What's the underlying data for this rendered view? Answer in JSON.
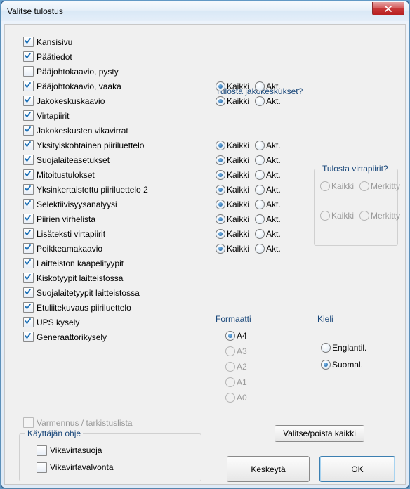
{
  "window": {
    "title": "Valitse tulostus"
  },
  "checks": [
    {
      "label": "Kansisivu",
      "checked": true
    },
    {
      "label": "Päätiedot",
      "checked": true
    },
    {
      "label": "Pääjohtokaavio, pysty",
      "checked": false
    },
    {
      "label": "Pääjohtokaavio, vaaka",
      "checked": true
    },
    {
      "label": "Jakokeskuskaavio",
      "checked": true
    },
    {
      "label": "Virtapiirit",
      "checked": true
    },
    {
      "label": "Jakokeskusten vikavirrat",
      "checked": true
    },
    {
      "label": "Yksityiskohtainen piiriluettelo",
      "checked": true
    },
    {
      "label": "Suojalaiteasetukset",
      "checked": true
    },
    {
      "label": "Mitoitustulokset",
      "checked": true
    },
    {
      "label": "Yksinkertaistettu piiriluettelo 2",
      "checked": true
    },
    {
      "label": "Selektiivisyysanalyysi",
      "checked": true
    },
    {
      "label": "Piirien virhelista",
      "checked": true
    },
    {
      "label": "Lisäteksti virtapiirit",
      "checked": true
    },
    {
      "label": "Poikkeamakaavio",
      "checked": true
    },
    {
      "label": "Laitteiston kaapelityypit",
      "checked": true
    },
    {
      "label": "Kiskotyypit laitteistossa",
      "checked": true
    },
    {
      "label": "Suojalaitetyypit laitteistossa",
      "checked": true
    },
    {
      "label": "Etuliitekuvaus piiriluettelo",
      "checked": true
    },
    {
      "label": "UPS kysely",
      "checked": true
    },
    {
      "label": "Generaattorikysely",
      "checked": true
    }
  ],
  "jakokeskukset": {
    "title": "Tulosta jakokeskukset?",
    "opt_all": "Kaikki",
    "opt_act": "Akt."
  },
  "virtapiirit": {
    "title": "Tulosta virtapiirit?",
    "opt_all": "Kaikki",
    "opt_marked": "Merkitty"
  },
  "format": {
    "title": "Formaatti",
    "options": [
      "A4",
      "A3",
      "A2",
      "A1",
      "A0"
    ],
    "selected": "A4"
  },
  "language": {
    "title": "Kieli",
    "opt_en": "Englantil.",
    "opt_fi": "Suomal.",
    "selected": "Suomal."
  },
  "extra_check": {
    "label": "Varmennus / tarkistuslista",
    "checked": false,
    "disabled": true
  },
  "user_guide": {
    "title": "Käyttäjän ohje",
    "items": [
      {
        "label": "Vikavirtasuoja",
        "checked": false
      },
      {
        "label": "Vikavirtavalvonta",
        "checked": false
      }
    ]
  },
  "buttons": {
    "toggle_all": "Valitse/poista kaikki",
    "cancel": "Keskeytä",
    "ok": "OK"
  }
}
